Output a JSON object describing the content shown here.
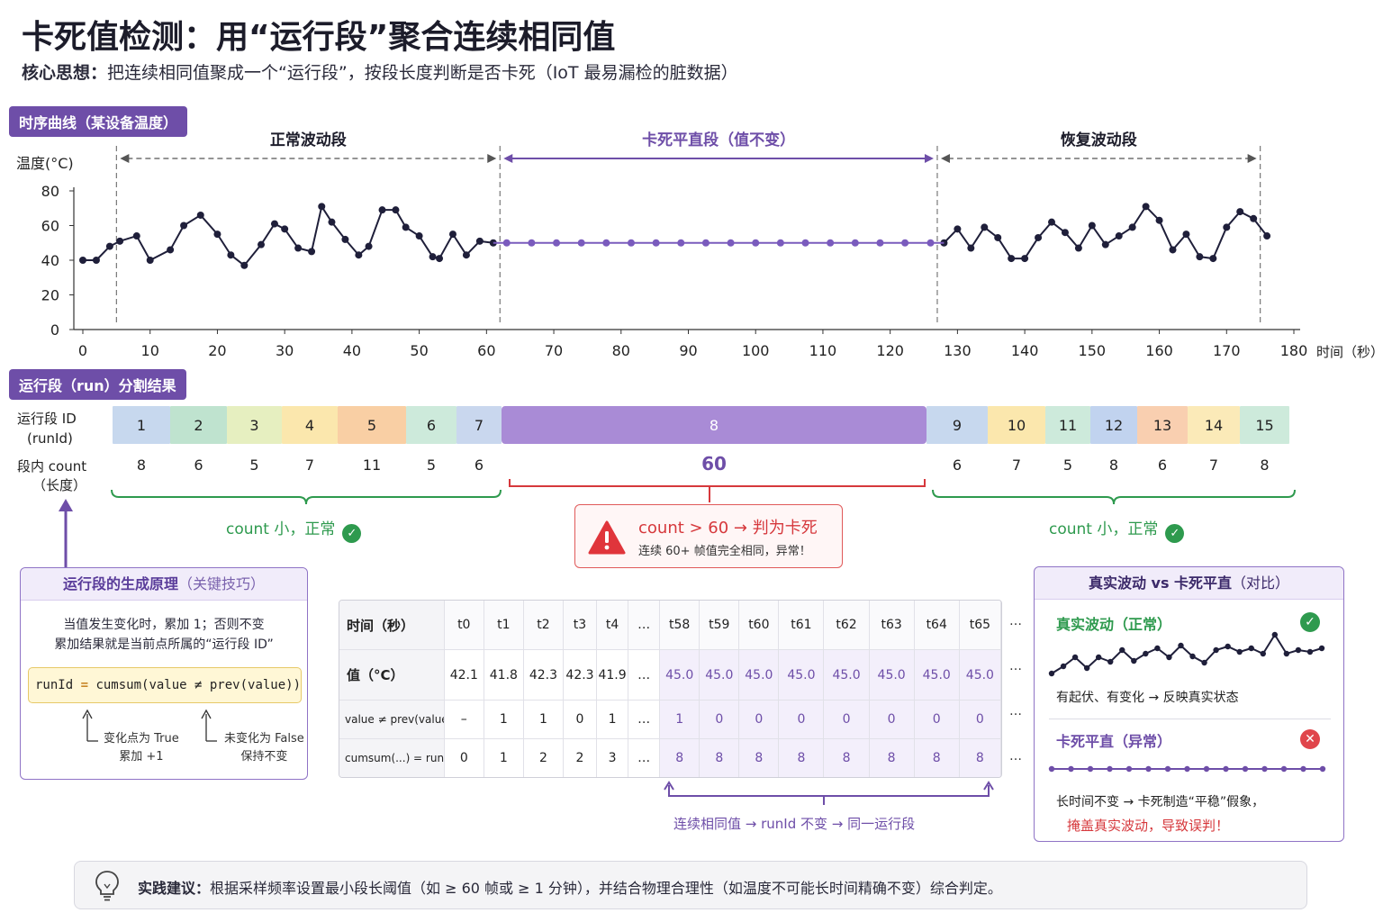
{
  "title": "卡死值检测：用“运行段”聚合连续相同值",
  "subtitle_label": "核心思想：",
  "subtitle_text": "把连续相同值聚成一个“运行段”，按段长度判断是否卡死（IoT 最易漏检的脏数据）",
  "chart_section_label": "时序曲线（某设备温度）",
  "runs_section_label": "运行段（run）分割结果",
  "chart_data": {
    "type": "line",
    "ylabel": "温度(°C)",
    "xlabel": "时间（秒）",
    "xlim": [
      0,
      180
    ],
    "ylim": [
      0,
      80
    ],
    "x_ticks": [
      0,
      10,
      20,
      30,
      40,
      50,
      60,
      70,
      80,
      90,
      100,
      110,
      120,
      130,
      140,
      150,
      160,
      170,
      180
    ],
    "y_ticks": [
      0,
      20,
      40,
      60,
      80
    ],
    "grid": false,
    "segment_labels": [
      {
        "text": "正常波动段",
        "from": 5,
        "to": 62,
        "color": "#555555"
      },
      {
        "text": "卡死平直段（值不变）",
        "from": 62,
        "to": 127,
        "color": "#6e4ea8"
      },
      {
        "text": "恢复波动段",
        "from": 127,
        "to": 175,
        "color": "#555555"
      }
    ],
    "series": [
      {
        "color": "#1f1f3a",
        "x": [
          0,
          2,
          4,
          5.5,
          8,
          10,
          13,
          15,
          17.5,
          20,
          22,
          24,
          26.5,
          28.5,
          30,
          32,
          34,
          35.5,
          37,
          39,
          41,
          42.5,
          44.5,
          46.5,
          48,
          50,
          52,
          53,
          55,
          57,
          59,
          61
        ],
        "y": [
          40,
          40,
          48,
          51,
          54,
          40,
          46,
          60,
          66,
          55,
          43,
          37,
          49,
          61,
          58,
          47,
          45,
          71,
          62,
          52,
          43,
          48,
          69,
          69,
          59,
          54,
          42,
          41,
          55,
          43,
          51,
          50
        ],
        "values_connected": true
      },
      {
        "color": "#7a5bbd",
        "x": [
          63,
          66.7,
          70.4,
          74.1,
          77.8,
          81.5,
          85.2,
          88.9,
          92.6,
          96.3,
          100,
          103.7,
          107.4,
          111.1,
          114.8,
          118.5,
          122.2,
          126
        ],
        "y": [
          50,
          50,
          50,
          50,
          50,
          50,
          50,
          50,
          50,
          50,
          50,
          50,
          50,
          50,
          50,
          50,
          50,
          50
        ]
      },
      {
        "color": "#1f1f3a",
        "x": [
          128,
          130,
          132,
          134,
          136,
          138,
          140,
          142,
          144,
          146,
          148,
          150,
          152,
          154,
          156,
          158,
          160,
          162,
          164,
          166,
          168,
          170,
          172,
          174,
          176
        ],
        "y": [
          50,
          58,
          47,
          59,
          53,
          41,
          41,
          53,
          62,
          56,
          47,
          60,
          49,
          54,
          59,
          71,
          63,
          46,
          55,
          42,
          41,
          59,
          68,
          64,
          54
        ]
      }
    ]
  },
  "runs": {
    "id_label_1": "运行段 ID",
    "id_label_2": "(runId)",
    "count_label_1": "段内 count",
    "count_label_2": "（长度）",
    "items": [
      {
        "id": "1",
        "count": "8",
        "color": "#c7d8ee"
      },
      {
        "id": "2",
        "count": "6",
        "color": "#bfe3cf"
      },
      {
        "id": "3",
        "count": "5",
        "color": "#e6efc0"
      },
      {
        "id": "4",
        "count": "7",
        "color": "#fbe7ad"
      },
      {
        "id": "5",
        "count": "11",
        "color": "#f9cfa4"
      },
      {
        "id": "6",
        "count": "5",
        "color": "#cdeadb"
      },
      {
        "id": "7",
        "count": "6",
        "color": "#c9d7ee"
      },
      {
        "id": "8",
        "count": "60",
        "color": "#a98bd6"
      },
      {
        "id": "9",
        "count": "6",
        "color": "#c7d8ee"
      },
      {
        "id": "10",
        "count": "7",
        "color": "#fbe7ad"
      },
      {
        "id": "11",
        "count": "5",
        "color": "#cdeadb"
      },
      {
        "id": "12",
        "count": "8",
        "color": "#c1d3ef"
      },
      {
        "id": "13",
        "count": "6",
        "color": "#f9cfb0"
      },
      {
        "id": "14",
        "count": "7",
        "color": "#fbeab8"
      },
      {
        "id": "15",
        "count": "8",
        "color": "#cdeadb"
      }
    ],
    "left_ok": "count 小，正常",
    "right_ok": "count 小，正常",
    "alert_title": "count > 60 → 判为卡死",
    "alert_sub": "连续 60+ 帧值完全相同，异常！"
  },
  "principle": {
    "head_bold": "运行段的生成原理",
    "head_light": "（关键技巧）",
    "line1": "当值发生变化时，累加 1；否则不变",
    "line2": "累加结果就是当前点所属的“运行段 ID”",
    "formula_a": "runId ",
    "formula_op": "=",
    "formula_b": " cumsum(value ≠ prev(value))",
    "note_left_1": "变化点为 True",
    "note_left_2": "累加 +1",
    "note_right_1": "未变化为 False",
    "note_right_2": "保持不变"
  },
  "table": {
    "row_heads": [
      "时间（秒）",
      "值（°C）",
      "value ≠ prev(value)",
      "cumsum(...) = runId"
    ],
    "cols": [
      "t0",
      "t1",
      "t2",
      "t3",
      "t4",
      "…",
      "t58",
      "t59",
      "t60",
      "t61",
      "t62",
      "t63",
      "t64",
      "t65"
    ],
    "values": [
      "42.1",
      "41.8",
      "42.3",
      "42.3",
      "41.9",
      "…",
      "45.0",
      "45.0",
      "45.0",
      "45.0",
      "45.0",
      "45.0",
      "45.0",
      "45.0"
    ],
    "changes": [
      "–",
      "1",
      "1",
      "0",
      "1",
      "…",
      "1",
      "0",
      "0",
      "0",
      "0",
      "0",
      "0",
      "0"
    ],
    "run_ids": [
      "0",
      "1",
      "2",
      "2",
      "3",
      "…",
      "8",
      "8",
      "8",
      "8",
      "8",
      "8",
      "8",
      "8"
    ],
    "trailing": "…",
    "brace_label": "连续相同值 → runId 不变 → 同一运行段"
  },
  "compare": {
    "head_bold": "真实波动 vs 卡死平直",
    "head_light": "（对比）",
    "real_title": "真实波动（正常）",
    "real_text": "有起伏、有变化 → 反映真实状态",
    "stuck_title": "卡死平直（异常）",
    "stuck_text": "长时间不变 → 卡死制造“平稳”假象，",
    "stuck_warn": "掩盖真实波动，导致误判！",
    "colors": {
      "ok": "#2e9a4e",
      "bad": "#e0454b",
      "accent": "#6e4ea8"
    }
  },
  "tip": {
    "label": "实践建议：",
    "text": "根据采样频率设置最小段长阈值（如 ≥ 60 帧或 ≥ 1 分钟），并结合物理合理性（如温度不可能长时间精确不变）综合判定。"
  }
}
